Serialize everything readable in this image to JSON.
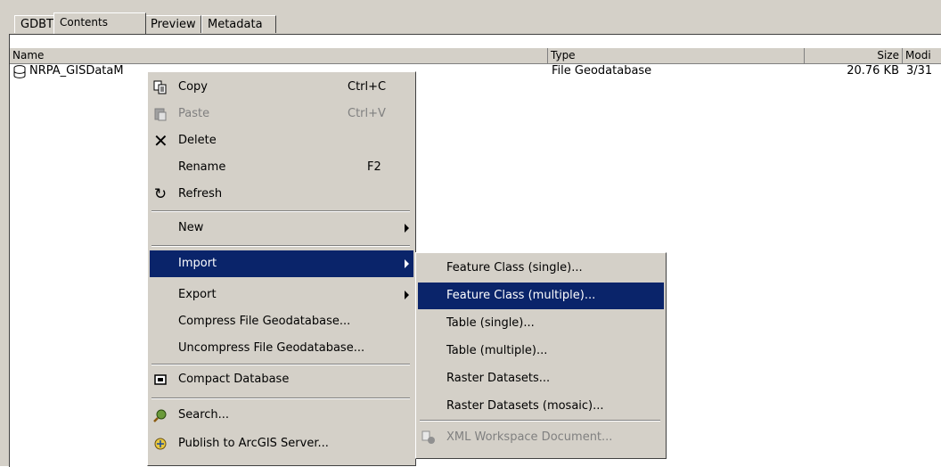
{
  "tabs": [
    {
      "label": "GDBT"
    },
    {
      "label": "Contents"
    },
    {
      "label": "Preview"
    },
    {
      "label": "Metadata"
    }
  ],
  "columns": {
    "name": "Name",
    "type": "Type",
    "size": "Size",
    "modified": "Modi"
  },
  "row": {
    "name": "NRPA_GISDataM",
    "type": "File Geodatabase",
    "size": "20.76 KB",
    "modified": "3/31"
  },
  "context_menu": [
    {
      "label": "Copy",
      "shortcut": "Ctrl+C",
      "icon": "copy-icon"
    },
    {
      "label": "Paste",
      "shortcut": "Ctrl+V",
      "icon": "paste-icon",
      "disabled": true
    },
    {
      "label": "Delete",
      "icon": "delete-icon"
    },
    {
      "label": "Rename",
      "shortcut": "F2"
    },
    {
      "label": "Refresh",
      "icon": "refresh-icon"
    },
    {
      "label": "New",
      "submenu": true
    },
    {
      "label": "Import",
      "submenu": true,
      "highlighted": true
    },
    {
      "label": "Export",
      "submenu": true
    },
    {
      "label": "Compress File Geodatabase..."
    },
    {
      "label": "Uncompress File Geodatabase..."
    },
    {
      "label": "Compact Database",
      "icon": "compact-database-icon"
    },
    {
      "label": "Search...",
      "icon": "search-icon"
    },
    {
      "label": "Publish to ArcGIS Server...",
      "icon": "publish-icon"
    }
  ],
  "submenu": [
    {
      "label": "Feature Class (single)..."
    },
    {
      "label": "Feature Class (multiple)...",
      "highlighted": true
    },
    {
      "label": "Table (single)..."
    },
    {
      "label": "Table (multiple)..."
    },
    {
      "label": "Raster Datasets..."
    },
    {
      "label": "Raster Datasets (mosaic)..."
    },
    {
      "label": "XML Workspace Document...",
      "disabled": true,
      "icon": "xml-workspace-icon"
    }
  ],
  "colors": {
    "highlight": "#0a246a",
    "menu_bg": "#d4d0c8"
  }
}
